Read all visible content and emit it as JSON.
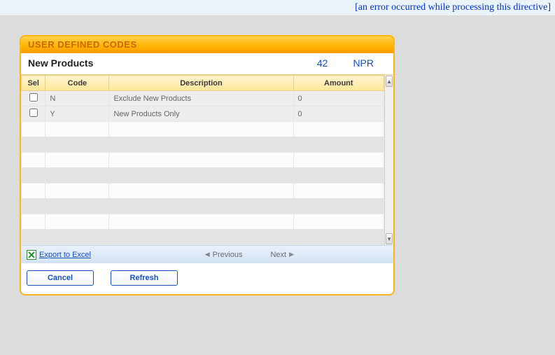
{
  "error_banner": "[an error occurred while processing this directive]",
  "panel": {
    "title": "USER DEFINED CODES",
    "subtitle": "New Products",
    "number": "42",
    "code_short": "NPR"
  },
  "columns": {
    "sel": "Sel",
    "code": "Code",
    "description": "Description",
    "amount": "Amount"
  },
  "rows": [
    {
      "sel": false,
      "code": "N",
      "description": "Exclude New Products",
      "amount": "0"
    },
    {
      "sel": false,
      "code": "Y",
      "description": "New Products Only",
      "amount": "0"
    }
  ],
  "footer": {
    "export": "Export to Excel",
    "previous": "Previous",
    "next": "Next"
  },
  "buttons": {
    "cancel": "Cancel",
    "refresh": "Refresh"
  }
}
